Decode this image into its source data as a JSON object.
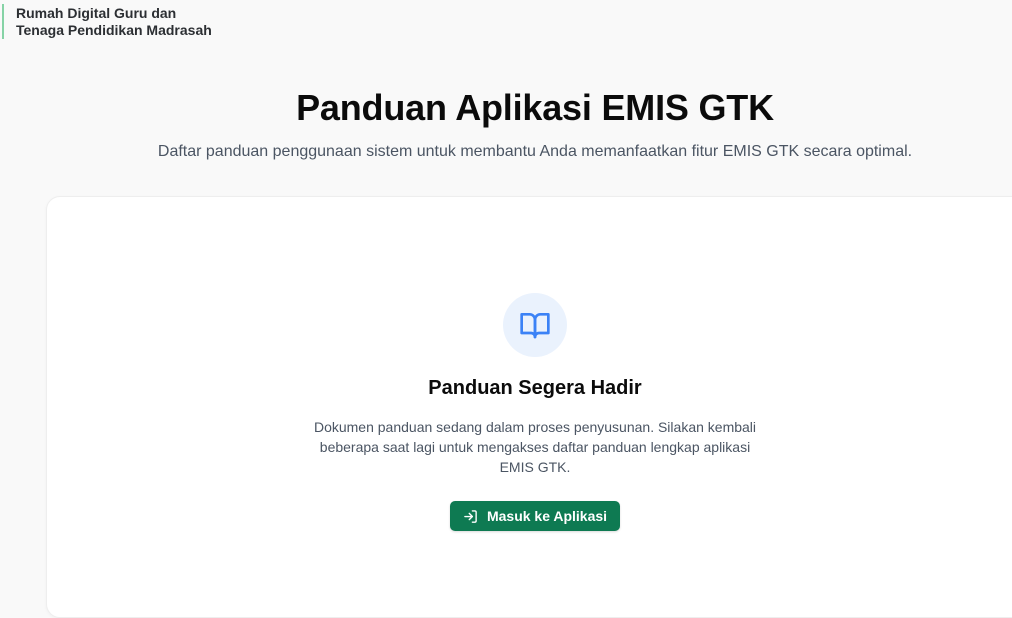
{
  "brand": {
    "line1": "Rumah Digital Guru dan",
    "line2": "Tenaga Pendidikan Madrasah",
    "accent_color": "#86d3a6"
  },
  "header": {
    "title": "Panduan Aplikasi EMIS GTK",
    "subtitle": "Daftar panduan penggunaan sistem untuk membantu Anda memanfaatkan fitur EMIS GTK secara optimal."
  },
  "empty_state": {
    "icon": "book-open-icon",
    "icon_color": "#3b82f6",
    "icon_bg": "#eaf2fd",
    "title": "Panduan Segera Hadir",
    "description": "Dokumen panduan sedang dalam proses penyusunan. Silakan kembali beberapa saat lagi untuk mengakses daftar panduan lengkap aplikasi EMIS GTK.",
    "button": {
      "label": "Masuk ke Aplikasi",
      "icon": "log-in-icon",
      "color": "#0e7a52"
    }
  }
}
